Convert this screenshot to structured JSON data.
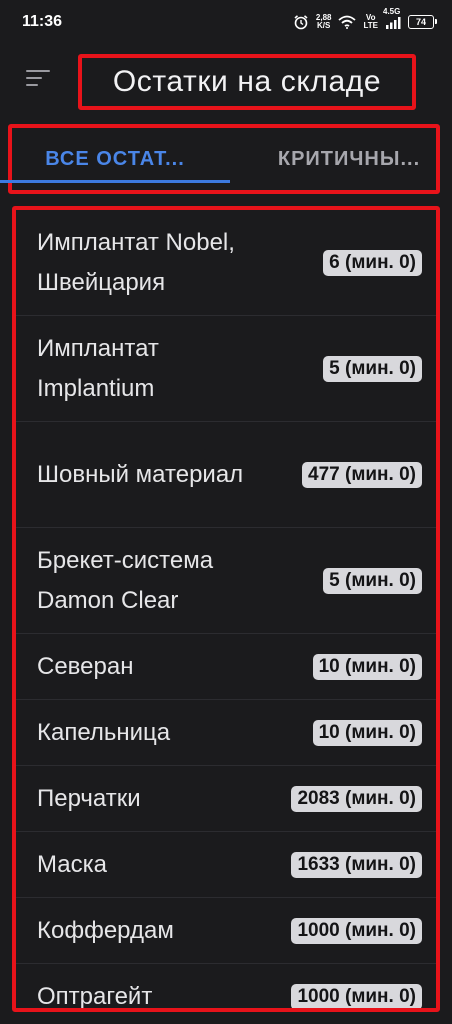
{
  "status_bar": {
    "time": "11:36",
    "net_speed_value": "2,88",
    "net_speed_unit": "K/S",
    "volte_top": "Vo",
    "volte_bottom": "LTE",
    "network_type": "4.5G",
    "battery": "74"
  },
  "header": {
    "title": "Остатки на складе",
    "menu_icon": "hamburger-menu-icon"
  },
  "tabs": [
    {
      "label": "ВСЕ ОСТАТ...",
      "active": true
    },
    {
      "label": "КРИТИЧНЫ...",
      "active": false
    }
  ],
  "items": [
    {
      "name": "Имплантат Nobel, Швейцария",
      "quantity": "6 (мин. 0)"
    },
    {
      "name": "Имплантат Implantium",
      "quantity": "5 (мин. 0)"
    },
    {
      "name": "Шовный материал",
      "quantity": "477 (мин. 0)"
    },
    {
      "name": "Брекет-система Damon Clear",
      "quantity": "5 (мин. 0)"
    },
    {
      "name": "Северан",
      "quantity": "10 (мин. 0)"
    },
    {
      "name": "Капельница",
      "quantity": "10 (мин. 0)"
    },
    {
      "name": "Перчатки",
      "quantity": "2083 (мин. 0)"
    },
    {
      "name": "Маска",
      "quantity": "1633 (мин. 0)"
    },
    {
      "name": "Коффердам",
      "quantity": "1000 (мин. 0)"
    },
    {
      "name": "Оптрагейт",
      "quantity": "1000 (мин. 0)"
    }
  ],
  "colors": {
    "background": "#1b1b1d",
    "accent": "#4a86e8",
    "highlight_outline": "#e8131a",
    "badge_bg": "#d8d8dc"
  }
}
